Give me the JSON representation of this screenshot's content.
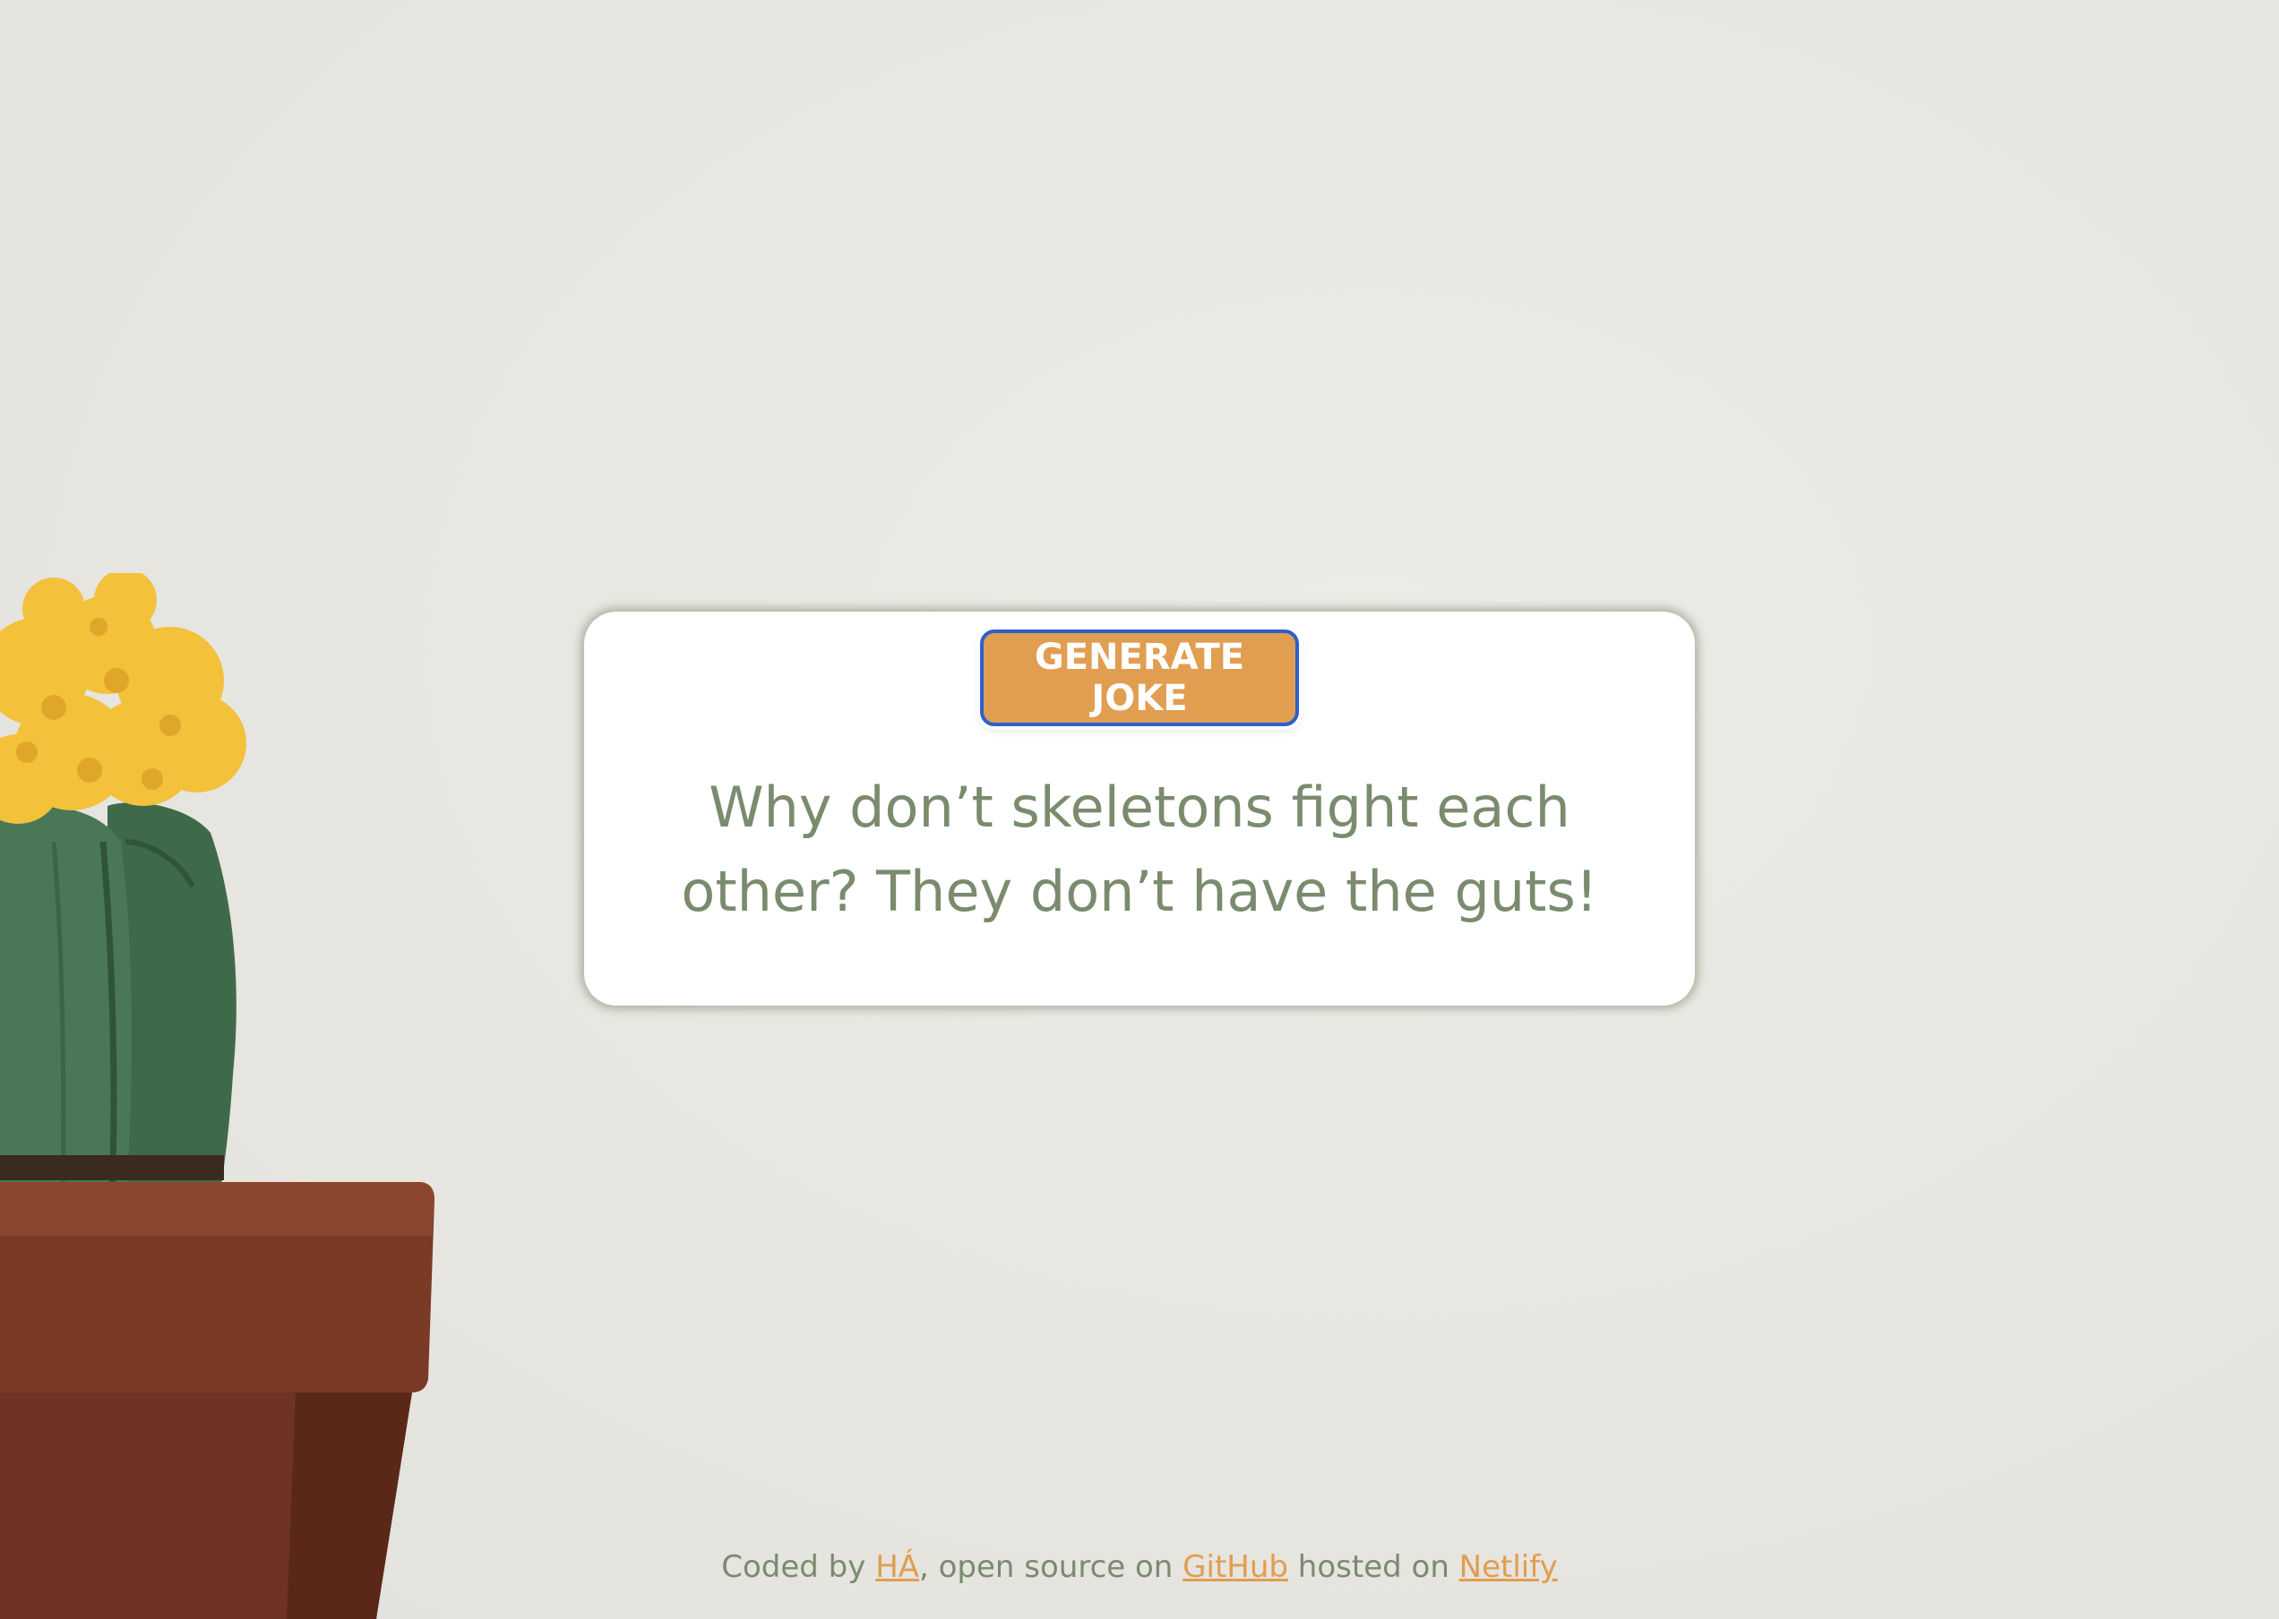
{
  "button": {
    "label": "GENERATE JOKE"
  },
  "joke": {
    "text": "Why don’t skeletons fight each other? They don’t have the guts!"
  },
  "footer": {
    "prefix": "Coded by ",
    "author_link": "HÁ",
    "middle": ", open source on ",
    "github_link": "GitHub",
    "hosted_text": " hosted on ",
    "netlify_link": "Netlify"
  },
  "colors": {
    "background": "#e7e6e1",
    "card": "#ffffff",
    "accent": "#e19d50",
    "text_green": "#7a8b6e",
    "button_border": "#2c5fcf"
  },
  "decor": {
    "illustration": "potted-cactus-with-yellow-flower"
  }
}
